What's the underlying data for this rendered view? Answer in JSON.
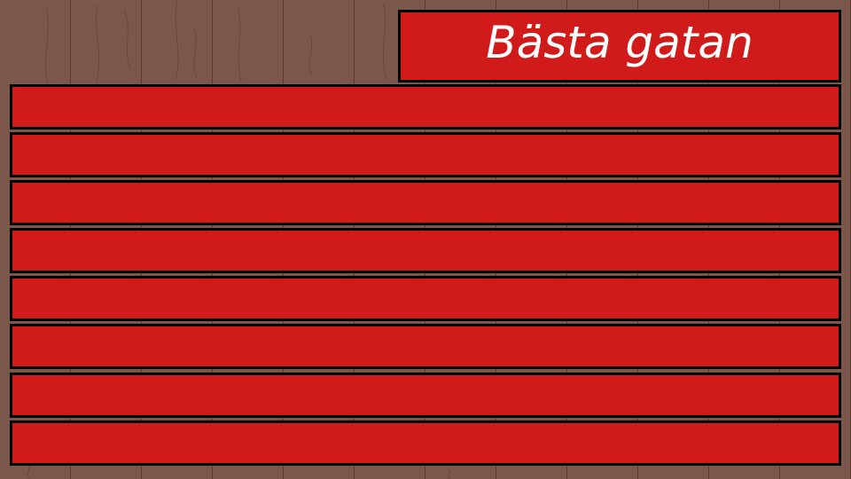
{
  "title": "Bästa gatan",
  "colors": {
    "board_background": "#7a574a",
    "panel_fill": "#d11a1a",
    "panel_border": "#000000",
    "title_text": "#ffffff"
  },
  "answers": [
    {
      "text": "",
      "points": ""
    },
    {
      "text": "",
      "points": ""
    },
    {
      "text": "",
      "points": ""
    },
    {
      "text": "",
      "points": ""
    },
    {
      "text": "",
      "points": ""
    },
    {
      "text": "",
      "points": ""
    },
    {
      "text": "",
      "points": ""
    },
    {
      "text": "",
      "points": ""
    }
  ]
}
